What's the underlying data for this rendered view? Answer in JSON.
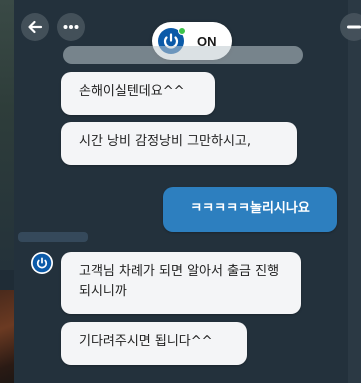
{
  "header": {
    "status_label": "ON",
    "logo_icon": "power-icon",
    "back_icon": "back-arrow-icon",
    "more_icon": "more-dots-icon",
    "minimize_icon": "minimize-icon",
    "status_color": "#3ec34a"
  },
  "messages": [
    {
      "sender": "agent",
      "text": "손해이실텐데요^^"
    },
    {
      "sender": "agent",
      "text": "시간 낭비 감정낭비 그만하시고,"
    },
    {
      "sender": "user",
      "text": "ㅋㅋㅋㅋㅋ놀리시나요"
    },
    {
      "sender": "agent",
      "text": "고객님 차례가 되면 알아서 출금 진행 되시니까"
    },
    {
      "sender": "agent",
      "text": "기다려주시면 됩니다^^"
    }
  ],
  "colors": {
    "user_bubble": "#2d7fbf",
    "agent_bubble": "#f4f5f7",
    "panel": "#23313c"
  }
}
